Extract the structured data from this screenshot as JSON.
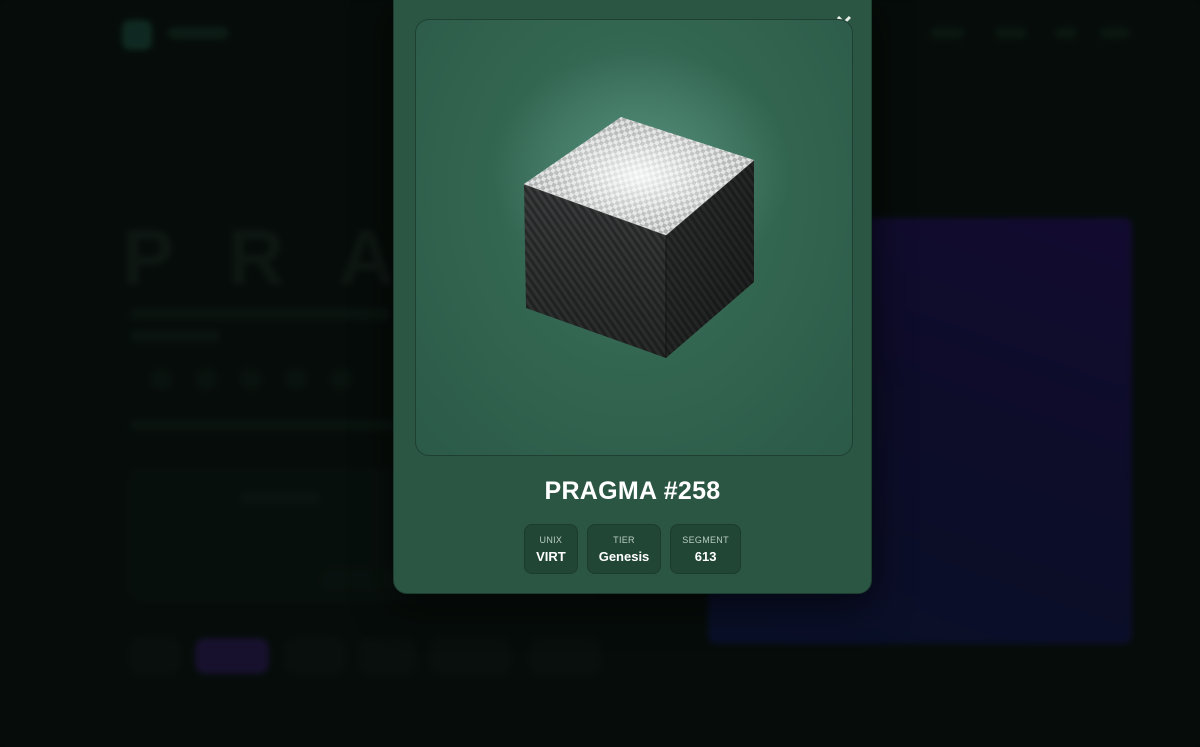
{
  "background": {
    "hero_title": "PRAG"
  },
  "modal": {
    "title": "PRAGMA #258",
    "close_icon": "close-icon",
    "artwork": "carbon-fiber-cube-illustration",
    "attributes": [
      {
        "label": "UNIX",
        "value": "VIRT"
      },
      {
        "label": "TIER",
        "value": "Genesis"
      },
      {
        "label": "SEGMENT",
        "value": "613"
      }
    ],
    "colors": {
      "modal_bg": "#2b5644",
      "artwork_bg": "#336651",
      "attr_bg": "#214636"
    }
  }
}
